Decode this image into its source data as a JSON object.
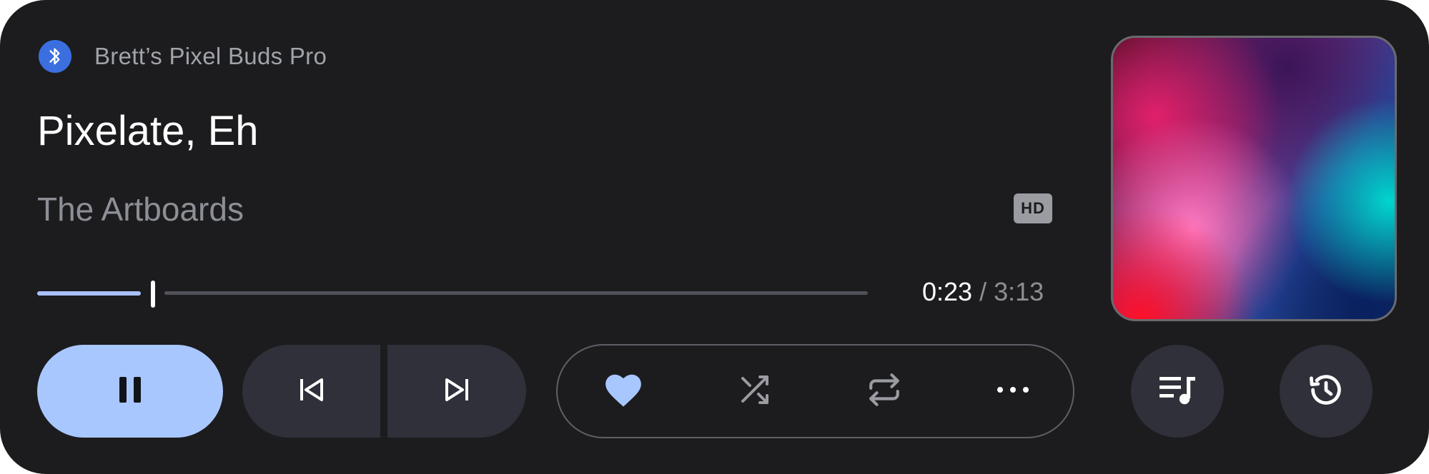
{
  "device": {
    "name": "Brett’s Pixel Buds Pro",
    "icon": "bluetooth-icon"
  },
  "track": {
    "title": "Pixelate, Eh",
    "artist": "The Artboards",
    "quality_badge": "HD"
  },
  "progress": {
    "elapsed": "0:23",
    "separator": " / ",
    "total": "3:13",
    "fraction": 0.12
  },
  "controls": {
    "pause": {
      "icon": "pause-icon"
    },
    "previous": {
      "icon": "skip-previous-icon"
    },
    "next": {
      "icon": "skip-next-icon"
    },
    "favorite": {
      "icon": "heart-icon"
    },
    "shuffle": {
      "icon": "shuffle-icon"
    },
    "repeat": {
      "icon": "repeat-icon"
    },
    "more": {
      "icon": "more-horizontal-icon"
    },
    "queue": {
      "icon": "queue-music-icon"
    },
    "history": {
      "icon": "history-icon"
    }
  },
  "colors": {
    "background": "#1c1c1e",
    "accent": "#a9c7ff",
    "button": "#2f3039",
    "bluetooth": "#3b6fe0"
  }
}
